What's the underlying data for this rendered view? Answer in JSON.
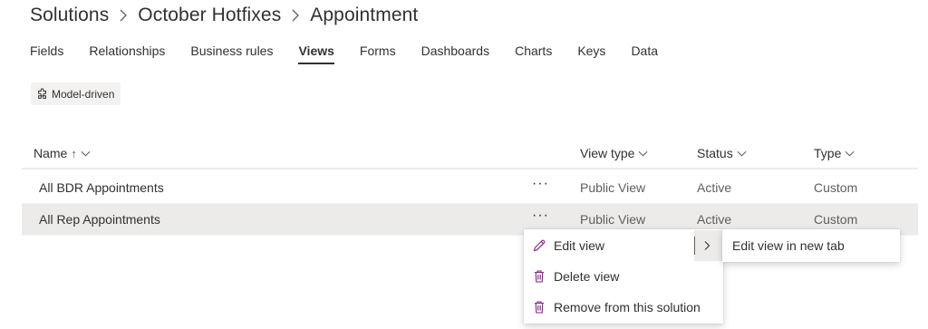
{
  "breadcrumb": {
    "items": [
      "Solutions",
      "October Hotfixes",
      "Appointment"
    ]
  },
  "tabs": [
    {
      "label": "Fields",
      "active": false
    },
    {
      "label": "Relationships",
      "active": false
    },
    {
      "label": "Business rules",
      "active": false
    },
    {
      "label": "Views",
      "active": true
    },
    {
      "label": "Forms",
      "active": false
    },
    {
      "label": "Dashboards",
      "active": false
    },
    {
      "label": "Charts",
      "active": false
    },
    {
      "label": "Keys",
      "active": false
    },
    {
      "label": "Data",
      "active": false
    }
  ],
  "filter_chip": {
    "label": "Model-driven",
    "icon": "puzzle-icon"
  },
  "grid": {
    "columns": {
      "name": "Name",
      "name_sort": "↑",
      "view_type": "View type",
      "status": "Status",
      "type": "Type"
    },
    "more_glyph": "···",
    "rows": [
      {
        "name": "All BDR Appointments",
        "view_type": "Public View",
        "status": "Active",
        "type": "Custom",
        "selected": false
      },
      {
        "name": "All Rep Appointments",
        "view_type": "Public View",
        "status": "Active",
        "type": "Custom",
        "selected": true
      }
    ]
  },
  "context_menu": {
    "items": [
      {
        "label": "Edit view",
        "icon": "pencil-icon"
      },
      {
        "label": "Delete view",
        "icon": "trash-icon"
      },
      {
        "label": "Remove from this solution",
        "icon": "trash-icon"
      }
    ],
    "submenu": {
      "label": "Edit view in new tab"
    }
  },
  "colors": {
    "accent_icon": "#8a1f8a",
    "selected_row": "#edebe9",
    "text": "#323130",
    "muted_text": "#605e5c"
  }
}
